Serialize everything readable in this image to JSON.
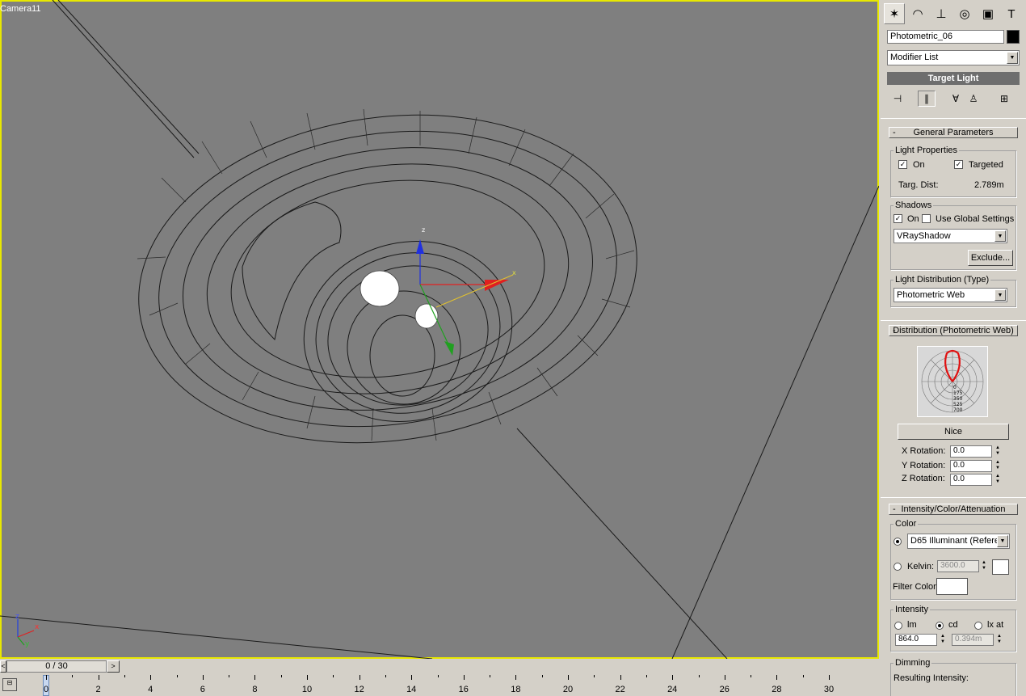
{
  "viewport": {
    "label": "Camera11",
    "axis_labels": {
      "x": "x",
      "y": "y",
      "z": "z"
    }
  },
  "panel": {
    "object_name": "Photometric_06",
    "object_color": "#000000",
    "modifier_list": "Modifier List",
    "stack_item": "Target Light",
    "general": {
      "title": "General Parameters",
      "light_props_title": "Light Properties",
      "on_label": "On",
      "on_checked": true,
      "targeted_label": "Targeted",
      "targeted_checked": true,
      "targ_dist_label": "Targ. Dist:",
      "targ_dist_value": "2.789m",
      "shadows_title": "Shadows",
      "shadows_on_label": "On",
      "shadows_on_checked": true,
      "use_global_label": "Use Global Settings",
      "use_global_checked": false,
      "shadow_type": "VRayShadow",
      "exclude_label": "Exclude...",
      "dist_type_title": "Light Distribution (Type)",
      "dist_type": "Photometric Web"
    },
    "distribution": {
      "title": "Distribution (Photometric Web)",
      "web_scale": [
        "0",
        "175",
        "350",
        "525",
        "700"
      ],
      "file_button": "Nice",
      "x_rot_label": "X Rotation:",
      "x_rot": "0.0",
      "y_rot_label": "Y Rotation:",
      "y_rot": "0.0",
      "z_rot_label": "Z Rotation:",
      "z_rot": "0.0"
    },
    "intensity": {
      "title": "Intensity/Color/Attenuation",
      "color_title": "Color",
      "preset": "D65 Illuminant (Refere",
      "kelvin_label": "Kelvin:",
      "kelvin_value": "3600.0",
      "filter_color_label": "Filter Color:",
      "intensity_title": "Intensity",
      "lm_label": "lm",
      "cd_label": "cd",
      "lx_label": "lx at",
      "intensity_value": "864.0",
      "lx_distance": "0.394m",
      "dimming_title": "Dimming",
      "resulting_label": "Resulting Intensity:"
    }
  },
  "timeline": {
    "frame_display": "0 / 30",
    "prev": "<",
    "next": ">",
    "ticks": [
      "0",
      "2",
      "4",
      "6",
      "8",
      "10",
      "12",
      "14",
      "16",
      "18",
      "20",
      "22",
      "24",
      "26",
      "28",
      "30"
    ]
  }
}
